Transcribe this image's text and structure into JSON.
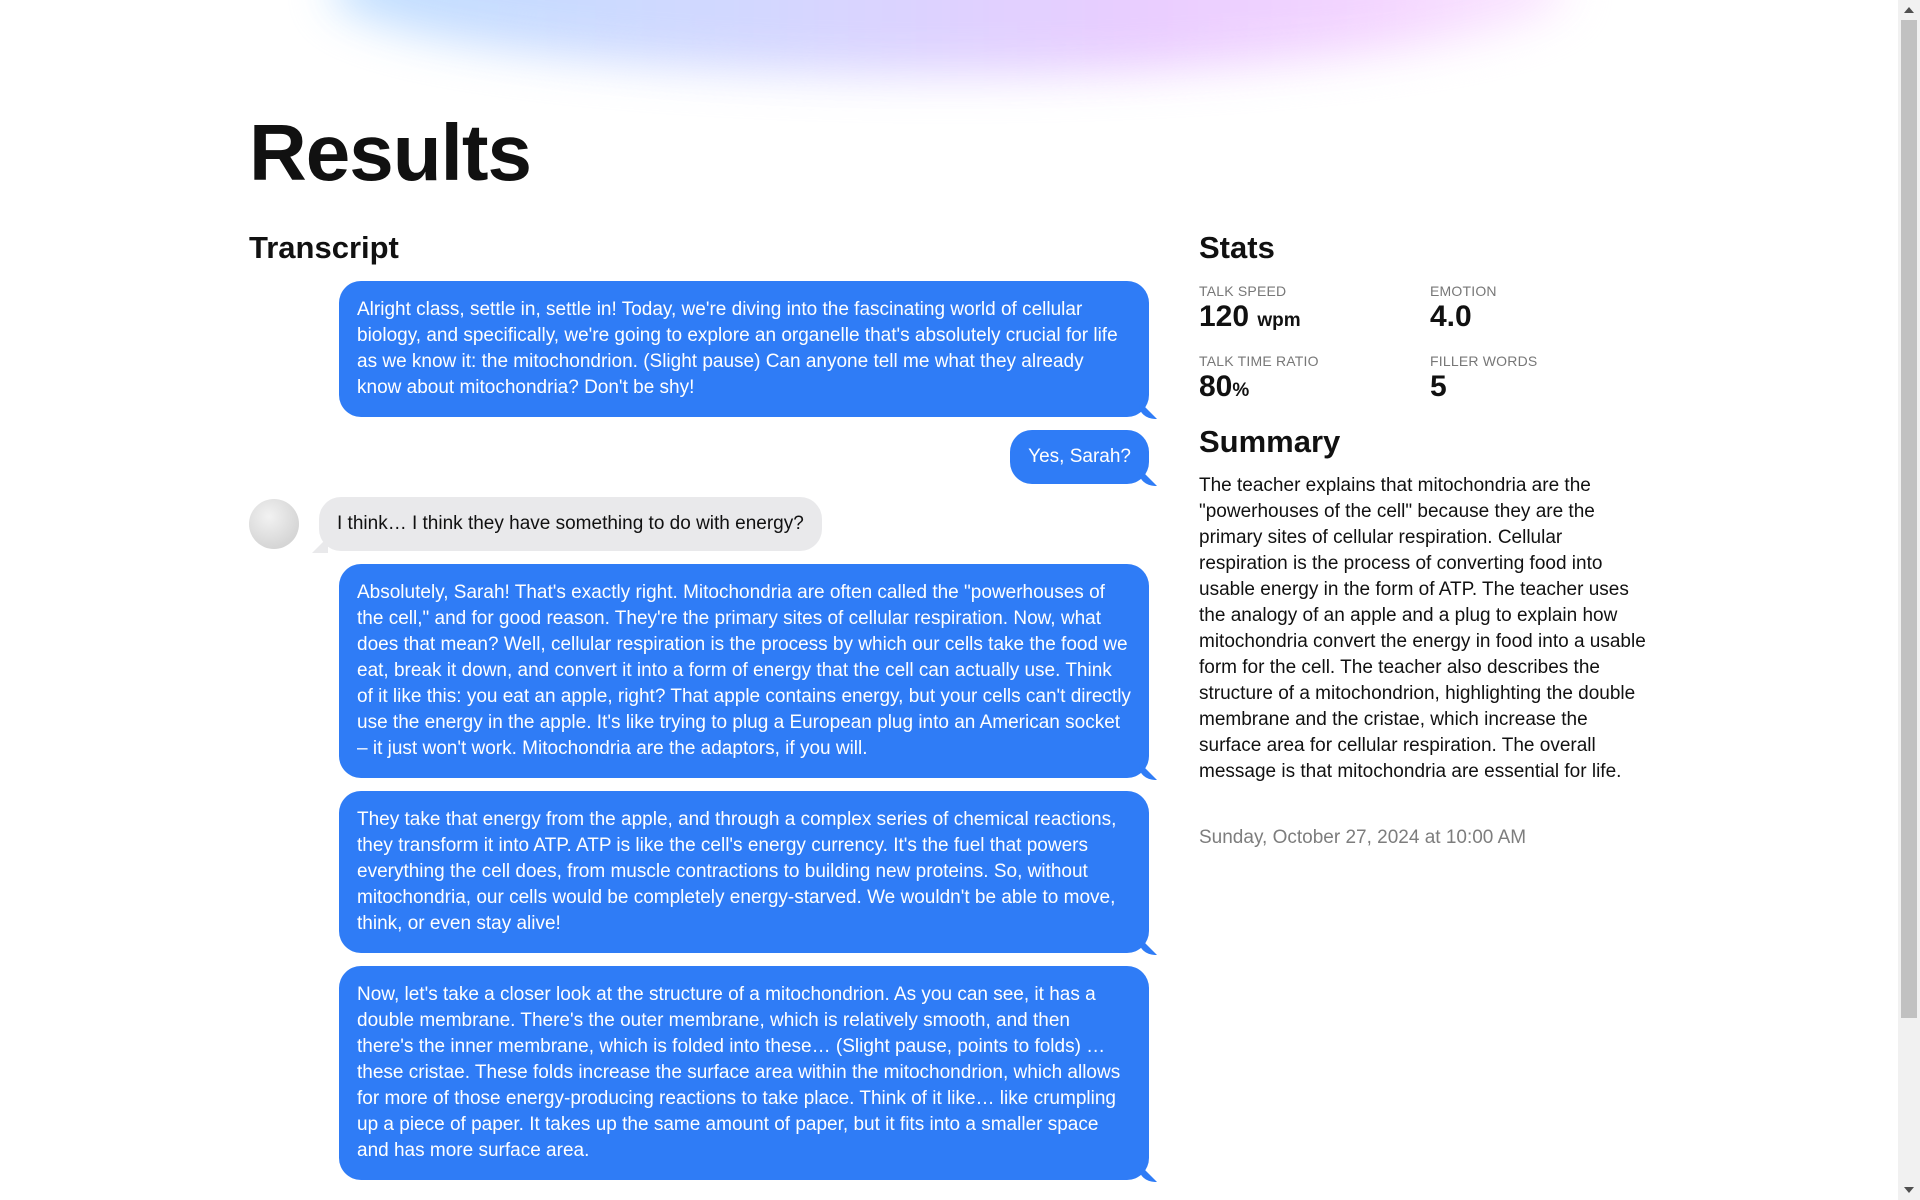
{
  "page": {
    "title": "Results"
  },
  "transcript": {
    "title": "Transcript",
    "messages": [
      {
        "speaker": "teacher",
        "text": "Alright class, settle in, settle in! Today, we're diving into the fascinating world of cellular biology, and specifically, we're going to explore an organelle that's absolutely crucial for life as we know it: the mitochondrion. (Slight pause) Can anyone tell me what they already know about mitochondria? Don't be shy!"
      },
      {
        "speaker": "teacher",
        "text": "Yes, Sarah?"
      },
      {
        "speaker": "student",
        "text": "I think… I think they have something to do with energy?"
      },
      {
        "speaker": "teacher",
        "text": "Absolutely, Sarah! That's exactly right. Mitochondria are often called the \"powerhouses of the cell,\" and for good reason. They're the primary sites of cellular respiration. Now, what does that mean? Well, cellular respiration is the process by which our cells take the food we eat, break it down, and convert it into a form of energy that the cell can actually use. Think of it like this: you eat an apple, right? That apple contains energy, but your cells can't directly use the energy in the apple. It's like trying to plug a European plug into an American socket – it just won't work. Mitochondria are the adaptors, if you will."
      },
      {
        "speaker": "teacher",
        "text": "They take that energy from the apple, and through a complex series of chemical reactions, they transform it into ATP. ATP is like the cell's energy currency. It's the fuel that powers everything the cell does, from muscle contractions to building new proteins. So, without mitochondria, our cells would be completely energy-starved. We wouldn't be able to move, think, or even stay alive!"
      },
      {
        "speaker": "teacher",
        "text": "Now, let's take a closer look at the structure of a mitochondrion. As you can see, it has a double membrane. There's the outer membrane, which is relatively smooth, and then there's the inner membrane, which is folded into these… (Slight pause, points to folds) … these cristae. These folds increase the surface area within the mitochondrion, which allows for more of those energy-producing reactions to take place. Think of it like… like crumpling up a piece of paper. It takes up the same amount of paper, but it fits into a smaller space and has more surface area."
      }
    ]
  },
  "stats": {
    "title": "Stats",
    "talk_speed": {
      "label": "TALK SPEED",
      "value": "120",
      "unit": "wpm"
    },
    "emotion": {
      "label": "EMOTION",
      "value": "4.0"
    },
    "talk_time_ratio": {
      "label": "TALK TIME RATIO",
      "value": "80",
      "unit": "%"
    },
    "filler_words": {
      "label": "FILLER WORDS",
      "value": "5"
    }
  },
  "summary": {
    "title": "Summary",
    "text": "The teacher explains that mitochondria are the \"powerhouses of the cell\" because they are the primary sites of cellular respiration. Cellular respiration is the process of converting food into usable energy in the form of ATP. The teacher uses the analogy of an apple and a plug to explain how mitochondria convert the energy in food into a usable form for the cell. The teacher also describes the structure of a mitochondrion, highlighting the double membrane and the cristae, which increase the surface area for cellular respiration. The overall message is that mitochondria are essential for life.",
    "date": "Sunday, October 27, 2024 at 10:00 AM"
  },
  "colors": {
    "teacher_bubble": "#2f7cf6",
    "student_bubble": "#e9e9eb",
    "muted_text": "#7d7d7d"
  }
}
